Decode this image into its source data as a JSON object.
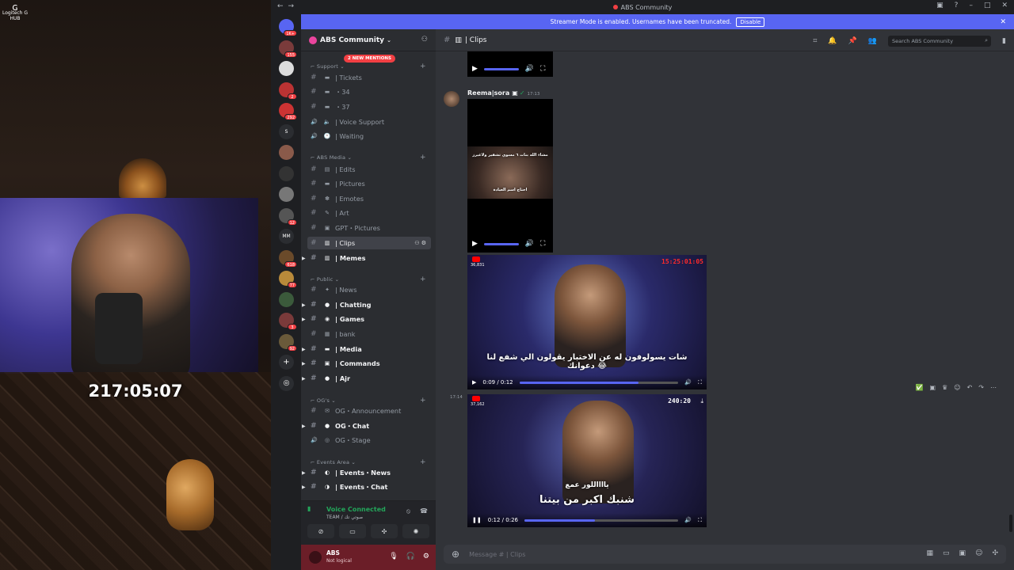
{
  "stream": {
    "logo_label": "Logitech G HUB",
    "timer": "217:05:07"
  },
  "window": {
    "title": "ABS Community",
    "banner_text": "Streamer Mode is enabled. Usernames have been truncated.",
    "banner_button": "Disable"
  },
  "rail": {
    "servers": [
      {
        "label": "",
        "badge": "1K+"
      },
      {
        "label": "",
        "badge": "155"
      },
      {
        "label": "",
        "badge": ""
      },
      {
        "label": "",
        "badge": "2"
      },
      {
        "label": "",
        "badge": "292"
      },
      {
        "label": "S",
        "badge": ""
      },
      {
        "label": "",
        "badge": ""
      },
      {
        "label": "",
        "badge": ""
      },
      {
        "label": "",
        "badge": ""
      },
      {
        "label": "",
        "badge": "12"
      },
      {
        "label": "MM",
        "badge": ""
      },
      {
        "label": "",
        "badge": "618"
      },
      {
        "label": "",
        "badge": "77"
      },
      {
        "label": "",
        "badge": ""
      },
      {
        "label": "",
        "badge": "3"
      },
      {
        "label": "",
        "badge": "92"
      }
    ]
  },
  "guild": {
    "name": "ABS Community",
    "mentions_pill": "2 NEW MENTIONS",
    "categories": [
      "Support",
      "ABS Media",
      "Public",
      "OG's",
      "Events Area"
    ],
    "channels": [
      {
        "name": "| Tickets",
        "emoji": "▬",
        "bold": false
      },
      {
        "name": "・34",
        "emoji": "▬",
        "bold": false
      },
      {
        "name": "・37",
        "emoji": "▬",
        "bold": false
      },
      {
        "name": "| Voice Support",
        "emoji": "🔈",
        "bold": false
      },
      {
        "name": "| Waiting",
        "emoji": "🕐",
        "bold": false
      },
      {
        "name": "| Edits",
        "emoji": "▤",
        "bold": false
      },
      {
        "name": "| Pictures",
        "emoji": "▬",
        "bold": false
      },
      {
        "name": "| Emotes",
        "emoji": "✽",
        "bold": false
      },
      {
        "name": "| Art",
        "emoji": "✎",
        "bold": false
      },
      {
        "name": "GPT・Pictures",
        "emoji": "▣",
        "bold": false
      },
      {
        "name": "| Clips",
        "emoji": "▥",
        "bold": false,
        "active": true
      },
      {
        "name": "| Memes",
        "emoji": "▥",
        "bold": true
      },
      {
        "name": "| News",
        "emoji": "✦",
        "bold": false
      },
      {
        "name": "| Chatting",
        "emoji": "●",
        "bold": true
      },
      {
        "name": "| Games",
        "emoji": "◉",
        "bold": true
      },
      {
        "name": "| bank",
        "emoji": "▦",
        "bold": false
      },
      {
        "name": "| Media",
        "emoji": "▬",
        "bold": true
      },
      {
        "name": "| Commands",
        "emoji": "▣",
        "bold": true
      },
      {
        "name": "| Ajr",
        "emoji": "●",
        "bold": true
      },
      {
        "name": "OG・Announcement",
        "emoji": "✉",
        "bold": false
      },
      {
        "name": "OG・Chat",
        "emoji": "●",
        "bold": true
      },
      {
        "name": "OG・Stage",
        "emoji": "◎",
        "bold": false
      },
      {
        "name": "| Events・News",
        "emoji": "◐",
        "bold": true
      },
      {
        "name": "| Events・Chat",
        "emoji": "◑",
        "bold": true
      }
    ]
  },
  "voice": {
    "status": "Voice Connected",
    "detail": "TEAM / صوتي تك"
  },
  "user": {
    "name": "ABS",
    "status": "Not logical"
  },
  "chat": {
    "channel_name": "| Clips",
    "search_placeholder": "Search ABS Community",
    "messages": [
      {
        "author": "Reema|sora",
        "time": "17:13",
        "overlay_top": "مشاء الله بنات ٦ مسوي تشفير ولاغيرز",
        "overlay_bottom": "احتاج اسم العيادة"
      },
      {
        "video_stamp": "15:25:01:05",
        "viewers": "36,831",
        "caption": "شات يسولوفون له عن الاختبار يقولون الي شفع لنا دعوانك 😂",
        "elapsed": "0:09 / 0:12",
        "progress": 0.75
      },
      {
        "time": "17:14",
        "video_stamp": "240:20",
        "viewers": "37,162",
        "caption_top": "يااااللور عمع",
        "caption": "شنبك اكبر من بيتنا",
        "elapsed": "0:12 / 0:26",
        "progress": 0.46
      }
    ],
    "composer_placeholder": "Message #  | Clips"
  },
  "colors": {
    "accent": "#5865f2",
    "danger": "#f23f43",
    "online": "#23a55a"
  }
}
